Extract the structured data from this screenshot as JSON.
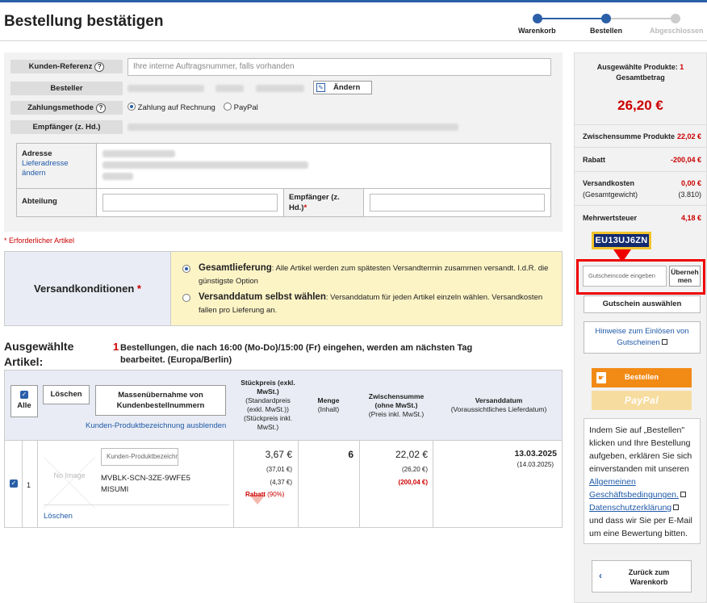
{
  "page": {
    "title": "Bestellung bestätigen",
    "brand_color": "#2b5fa8",
    "accent_color": "#f28a16"
  },
  "steps": [
    {
      "label": "Warenkorb",
      "state": "done"
    },
    {
      "label": "Bestellen",
      "state": "active"
    },
    {
      "label": "Abgeschlossen",
      "state": "todo"
    }
  ],
  "form": {
    "kunden_referenz_label": "Kunden-Referenz",
    "kunden_referenz_placeholder": "Ihre interne Auftragsnummer, falls vorhanden",
    "besteller_label": "Besteller",
    "aendern_label": "Ändern",
    "zahlungsmethode_label": "Zahlungsmethode",
    "payment_options": [
      "Zahlung auf Rechnung",
      "PayPal"
    ],
    "payment_selected": "Zahlung auf Rechnung",
    "empfaenger_label": "Empfänger (z. Hd.)",
    "adresse_label": "Adresse",
    "lieferadresse_link": "Lieferadresse ändern",
    "abteilung_label": "Abteilung",
    "empfaenger2_label": "Empfänger (z. Hd.)",
    "required_mark": "*",
    "required_note": "* Erforderlicher Artikel"
  },
  "versand": {
    "title": "Versandkonditionen",
    "required_mark": "*",
    "opt1_title": "Gesamtlieferung",
    "opt1_text": ": Alle Artikel werden zum spätesten Versandtermin zusammen versandt. I.d.R. die günstigste Option",
    "opt2_title": "Versanddatum selbst wählen",
    "opt2_text": ": Versanddatum für jeden Artikel einzeln wählen. Versandkosten fallen pro Lieferung an.",
    "selected": 1
  },
  "articles": {
    "title": "Ausgewählte Artikel:",
    "notice_number": "1",
    "notice": "Bestellungen, die nach 16:00 (Mo-Do)/15:00 (Fr) eingehen, werden am nächsten Tag bearbeitet. (Europa/Berlin)",
    "head": {
      "all_label": "Alle",
      "delete_label": "Löschen",
      "mass_label": "Massenübernahme von Kundenbestellnummern",
      "hide_link": "Kunden-Produktbezeichnung ausblenden",
      "unit_price": "Stückpreis (exkl. MwSt.)",
      "unit_price_sub": "(Standardpreis (exkl. MwSt.)) (Stückpreis inkl. MwSt.)",
      "qty": "Menge",
      "qty_sub": "(Inhalt)",
      "subtotal": "Zwischensumme (ohne MwSt.)",
      "subtotal_sub": "(Preis inkl. MwSt.)",
      "ship_date": "Versanddatum",
      "ship_date_sub": "(Voraussichtliches Lieferdatum)"
    },
    "rows": [
      {
        "index": "1",
        "checked": true,
        "no_image": "No Image",
        "customer_desc_placeholder": "Kunden-Produktbezeichnung",
        "part_number": "MVBLK-SCN-3ZE-9WFE5",
        "brand": "MISUMI",
        "delete_label": "Löschen",
        "unit_price": "3,67 €",
        "std_price": "(37,01 €)",
        "price_incl": "(4,37 €)",
        "discount_label": "Rabatt",
        "discount_pct": "(90%)",
        "qty": "6",
        "subtotal": "22,02 €",
        "subtotal_incl": "(26,20 €)",
        "subtotal_discount": "(200,04 €)",
        "ship_date": "13.03.2025",
        "delivery_date": "(14.03.2025)"
      }
    ]
  },
  "sidebar": {
    "selected_products_label": "Ausgewählte Produkte:",
    "selected_products_count": "1",
    "total_label": "Gesamtbetrag",
    "total": "26,20 €",
    "rows": [
      {
        "label": "Zwischensumme Produkte",
        "value": "22,02 €"
      },
      {
        "label": "Rabatt",
        "value": "-200,04 €"
      },
      {
        "label": "Versandkosten",
        "value": "0,00 €",
        "sub_label": "(Gesamtgewicht)",
        "sub_value": "(3.810)"
      },
      {
        "label": "Mehrwertsteuer",
        "value": "4,18 €"
      }
    ],
    "coupon_code": "EU13UJ6ZN",
    "coupon_placeholder": "Gutscheincode eingeben",
    "apply_label": "Übernehmen",
    "choose_coupon_label": "Gutschein auswählen",
    "redeem_hint_label": "Hinweise zum Einlösen von Gutscheinen",
    "order_button": "Bestellen",
    "paypal_button": "PayPal",
    "legal_pre": "Indem Sie auf „Bestellen\" klicken und Ihre Bestellung aufgeben, erklären Sie sich einverstanden mit unseren",
    "legal_link1": "Allgemeinen Geschäftsbedingungen.",
    "legal_link2": "Datenschutzerklärung",
    "legal_post": "und dass wir Sie per E-Mail um eine Bewertung bitten.",
    "back_label": "Zurück zum Warenkorb"
  }
}
